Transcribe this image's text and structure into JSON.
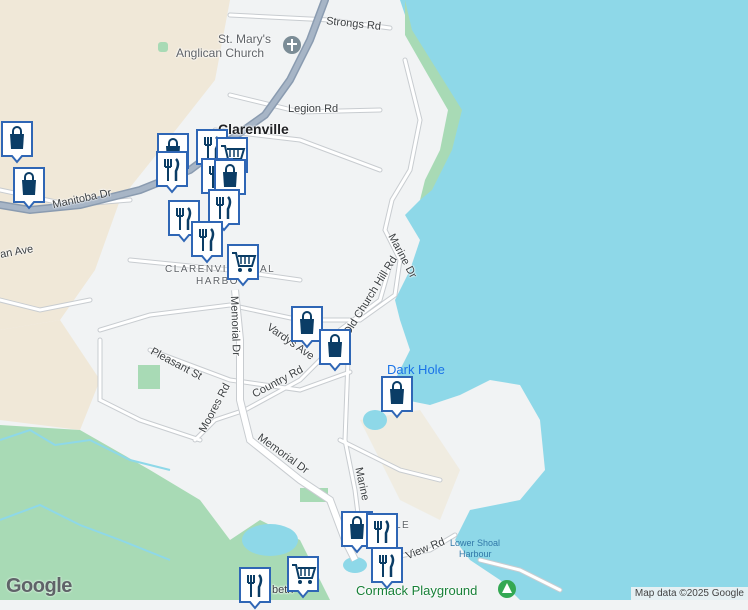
{
  "colors": {
    "water": "#8ed8e8",
    "land": "#f1f3f4",
    "beige": "#f0e8d8",
    "forest": "#a8dab5",
    "road": "#ffffff",
    "roadEdge": "#c8ccd0",
    "highway": "#8a9bb0",
    "marker": "#2f66b5",
    "markerIcon": "#0b3d66"
  },
  "streets": {
    "strongs": "Strongs Rd",
    "legion": "Legion Rd",
    "manitoba": "Manitoba Dr",
    "an_ave": "an Ave",
    "marine_top": "Marine Dr",
    "old_church": "Old Church Hill Rd",
    "memorial_top": "Memorial Dr",
    "vardys": "Vardys Ave",
    "country": "Country Rd",
    "pleasant": "Pleasant St",
    "moores": "Moores Rd",
    "memorial_bottom": "Memorial Dr",
    "marine_bottom": "Marine",
    "view": "View Rd",
    "beth": "beth"
  },
  "places": {
    "church_line1": "St. Mary's",
    "church_line2": "Anglican Church",
    "town": "Clarenville",
    "harbour_line1": "CLARENVILLE",
    "harbour_line1b": "AL",
    "harbour_line2": "HARBO",
    "dark_hole": "Dark Hole",
    "lower_shoal_1": "Lower Shoal",
    "lower_shoal_2": "Harbour",
    "cormack": "Cormack Playground",
    "le": "LE"
  },
  "markers": [
    {
      "type": "shopping-bag"
    },
    {
      "type": "shopping-bag"
    },
    {
      "type": "shopping-bag"
    },
    {
      "type": "restaurant"
    },
    {
      "type": "restaurant"
    },
    {
      "type": "grocery-cart"
    },
    {
      "type": "restaurant"
    },
    {
      "type": "shopping-bag"
    },
    {
      "type": "restaurant"
    },
    {
      "type": "restaurant"
    },
    {
      "type": "restaurant"
    },
    {
      "type": "grocery-cart"
    },
    {
      "type": "shopping-bag"
    },
    {
      "type": "shopping-bag"
    },
    {
      "type": "shopping-bag"
    },
    {
      "type": "shopping-bag"
    },
    {
      "type": "restaurant"
    },
    {
      "type": "restaurant"
    },
    {
      "type": "restaurant"
    },
    {
      "type": "grocery-cart"
    }
  ],
  "footer": {
    "logo": "Google",
    "attribution": "Map data ©2025 Google"
  }
}
